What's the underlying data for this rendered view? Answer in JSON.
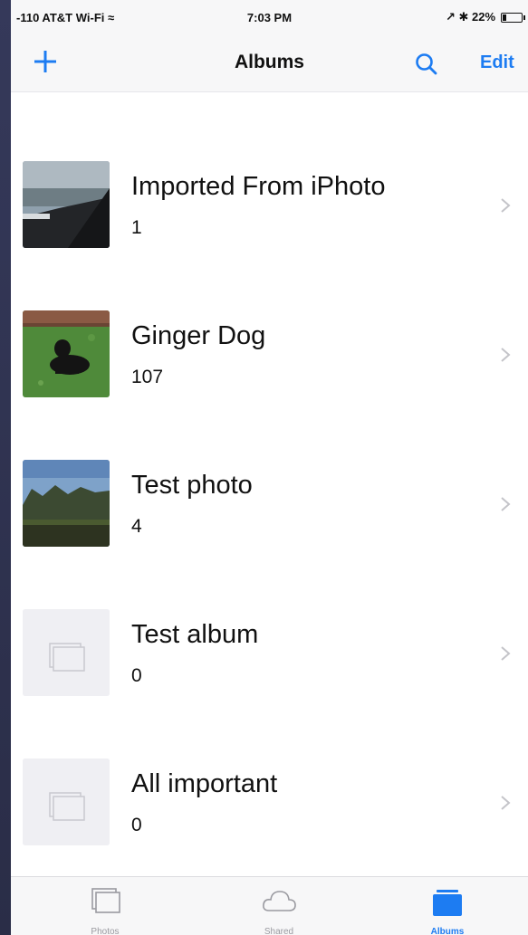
{
  "status_bar": {
    "carrier": "-110 AT&T Wi-Fi ≈",
    "time": "7:03 PM",
    "right": "↗ ✱ 22%",
    "battery_level": 0.22
  },
  "nav": {
    "title": "Albums",
    "add_icon": "plus-icon",
    "search_icon": "search-icon",
    "edit_label": "Edit",
    "accent": "#1d7cf2"
  },
  "albums": [
    {
      "title": "Imported From iPhoto",
      "count": "1",
      "thumb": "photo-landscape-dark"
    },
    {
      "title": "Ginger Dog",
      "count": "107",
      "thumb": "photo-dog-on-grass"
    },
    {
      "title": "Test photo",
      "count": "4",
      "thumb": "photo-trees-sky"
    },
    {
      "title": "Test album",
      "count": "0",
      "thumb": "empty-album-icon"
    },
    {
      "title": "All important",
      "count": "0",
      "thumb": "empty-album-icon"
    }
  ],
  "tabs": [
    {
      "label": "Photos",
      "icon": "photos-icon",
      "active": false
    },
    {
      "label": "Shared",
      "icon": "cloud-icon",
      "active": false
    },
    {
      "label": "Albums",
      "icon": "albums-icon",
      "active": true
    }
  ]
}
